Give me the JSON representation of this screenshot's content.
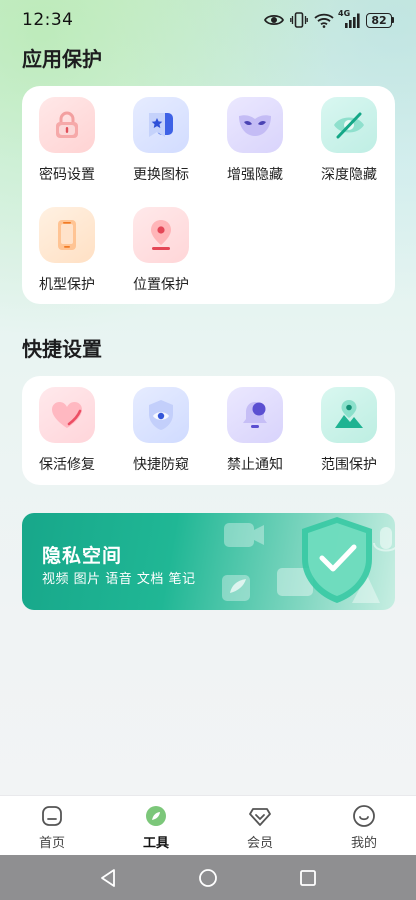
{
  "status_bar": {
    "time": "12:34",
    "battery": "82",
    "network": "4G"
  },
  "sections": {
    "app_protection": {
      "title": "应用保护",
      "items": [
        {
          "label": "密码设置",
          "icon": "lock-icon"
        },
        {
          "label": "更换图标",
          "icon": "bookmark-star-icon"
        },
        {
          "label": "增强隐藏",
          "icon": "mask-icon"
        },
        {
          "label": "深度隐藏",
          "icon": "eye-off-icon"
        },
        {
          "label": "机型保护",
          "icon": "phone-icon"
        },
        {
          "label": "位置保护",
          "icon": "location-pin-icon"
        }
      ]
    },
    "quick_settings": {
      "title": "快捷设置",
      "items": [
        {
          "label": "保活修复",
          "icon": "heart-icon"
        },
        {
          "label": "快捷防窥",
          "icon": "shield-eye-icon"
        },
        {
          "label": "禁止通知",
          "icon": "bell-icon"
        },
        {
          "label": "范围保护",
          "icon": "map-pin-icon"
        }
      ]
    }
  },
  "banner": {
    "title": "隐私空间",
    "subtitle": "视频 图片 语音 文档 笔记"
  },
  "bottom_nav": {
    "items": [
      {
        "label": "首页",
        "icon": "home-icon"
      },
      {
        "label": "工具",
        "icon": "leaf-icon",
        "active": true
      },
      {
        "label": "会员",
        "icon": "diamond-icon"
      },
      {
        "label": "我的",
        "icon": "smile-icon"
      }
    ]
  },
  "colors": {
    "accent": "#1fb392",
    "banner_start": "#17a78a",
    "text_primary": "#1d1d1f"
  }
}
